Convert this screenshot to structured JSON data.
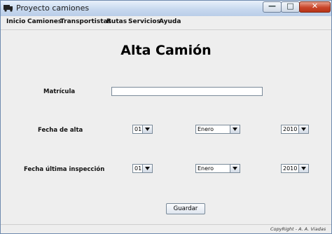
{
  "window": {
    "title": "Proyecto camiones",
    "controls": {
      "minimize": "—",
      "maximize": "□",
      "close": "✕"
    }
  },
  "menu": [
    "Inicio",
    "Camiones",
    "Transportistas",
    "Rutas",
    "Servicios",
    "Ayuda"
  ],
  "form": {
    "heading": "Alta Camión",
    "matricula_label": "Matrícula",
    "matricula_value": "",
    "fecha_alta_label": "Fecha de alta",
    "fecha_inspeccion_label": "Fecha última inspección",
    "fecha_alta": {
      "day": "01",
      "month": "Enero",
      "year": "2010"
    },
    "fecha_inspeccion": {
      "day": "01",
      "month": "Enero",
      "year": "2010"
    },
    "save_label": "Guardar"
  },
  "footer": {
    "copyright": "CopyRight - A. A. Viadas"
  }
}
